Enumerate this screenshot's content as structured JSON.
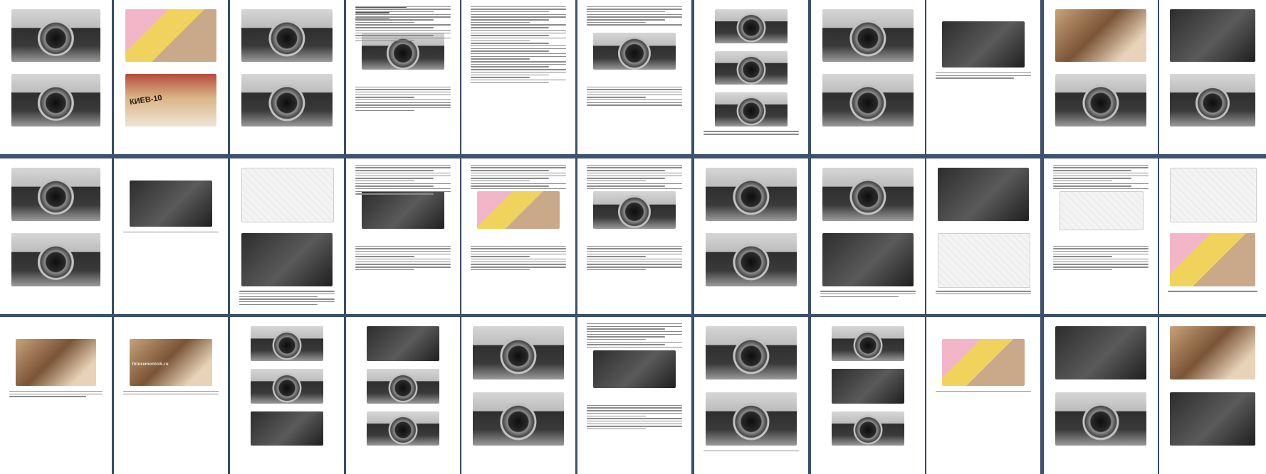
{
  "rows": [
    [
      {
        "photos": [
          {
            "kind": "cam"
          },
          {
            "kind": "cam"
          }
        ],
        "caption": "",
        "text_lines": 0
      },
      {
        "photos": [
          {
            "kind": "color"
          },
          {
            "kind": "book"
          }
        ],
        "caption": "",
        "text_lines": 0,
        "book_word": "КИЕВ-10"
      },
      {
        "photos": [
          {
            "kind": "cam"
          },
          {
            "kind": "cam"
          }
        ],
        "caption": "",
        "text_lines": 0
      },
      {
        "photos": [
          {
            "kind": "cam"
          }
        ],
        "caption": "",
        "text_lines": 14,
        "has_title": true
      },
      {
        "photos": [],
        "caption": "",
        "text_lines": 30
      },
      {
        "photos": [
          {
            "kind": "cam"
          }
        ],
        "caption": "",
        "text_lines": 8
      },
      {
        "photos": [
          {
            "kind": "cam"
          },
          {
            "kind": "cam"
          },
          {
            "kind": "cam"
          }
        ],
        "caption": "",
        "text_lines": 2
      },
      {
        "photos": [
          {
            "kind": "cam"
          },
          {
            "kind": "cam"
          }
        ],
        "caption": "",
        "text_lines": 0
      },
      {
        "photos": [
          {
            "kind": "dark"
          }
        ],
        "caption": "",
        "text_lines": 3
      },
      {
        "photos": [
          {
            "kind": "warm"
          },
          {
            "kind": "cam"
          }
        ],
        "caption": "",
        "text_lines": 0
      },
      {
        "photos": [
          {
            "kind": "dark"
          },
          {
            "kind": "cam"
          }
        ],
        "caption": "",
        "text_lines": 0
      }
    ],
    [
      {
        "photos": [
          {
            "kind": "cam"
          },
          {
            "kind": "cam"
          }
        ],
        "caption": "",
        "text_lines": 0
      },
      {
        "photos": [
          {
            "kind": "dark"
          }
        ],
        "caption": "",
        "text_lines": 1
      },
      {
        "photos": [
          {
            "kind": "diagram"
          },
          {
            "kind": "dark"
          }
        ],
        "caption": "",
        "text_lines": 6
      },
      {
        "photos": [
          {
            "kind": "dark"
          }
        ],
        "caption": "",
        "text_lines": 12
      },
      {
        "photos": [
          {
            "kind": "color"
          }
        ],
        "caption": "",
        "text_lines": 10
      },
      {
        "photos": [
          {
            "kind": "cam"
          }
        ],
        "caption": "",
        "text_lines": 10
      },
      {
        "photos": [
          {
            "kind": "cam"
          },
          {
            "kind": "cam"
          }
        ],
        "caption": "",
        "text_lines": 0
      },
      {
        "photos": [
          {
            "kind": "cam"
          },
          {
            "kind": "dark"
          }
        ],
        "caption": "",
        "text_lines": 3
      },
      {
        "photos": [
          {
            "kind": "dark"
          },
          {
            "kind": "diagram"
          }
        ],
        "caption": "",
        "text_lines": 2
      },
      {
        "photos": [
          {
            "kind": "diagram"
          }
        ],
        "caption": "",
        "text_lines": 10
      },
      {
        "photos": [
          {
            "kind": "diagram"
          },
          {
            "kind": "color"
          }
        ],
        "caption": "",
        "text_lines": 1
      }
    ],
    [
      {
        "photos": [
          {
            "kind": "warm"
          }
        ],
        "caption": "",
        "text_lines": 3
      },
      {
        "photos": [
          {
            "kind": "warm"
          }
        ],
        "caption": "",
        "text_lines": 2,
        "watermark": "fotoremontnik.ru"
      },
      {
        "photos": [
          {
            "kind": "cam"
          },
          {
            "kind": "cam"
          },
          {
            "kind": "dark"
          }
        ],
        "caption": "",
        "text_lines": 0
      },
      {
        "photos": [
          {
            "kind": "dark"
          },
          {
            "kind": "cam"
          },
          {
            "kind": "cam"
          }
        ],
        "caption": "",
        "text_lines": 0
      },
      {
        "photos": [
          {
            "kind": "cam"
          },
          {
            "kind": "cam"
          }
        ],
        "caption": "",
        "text_lines": 0
      },
      {
        "photos": [
          {
            "kind": "dark"
          }
        ],
        "caption": "",
        "text_lines": 10
      },
      {
        "photos": [
          {
            "kind": "cam"
          },
          {
            "kind": "cam"
          }
        ],
        "caption": "",
        "text_lines": 1
      },
      {
        "photos": [
          {
            "kind": "cam"
          },
          {
            "kind": "dark"
          },
          {
            "kind": "cam"
          }
        ],
        "caption": "",
        "text_lines": 0
      },
      {
        "photos": [
          {
            "kind": "color"
          }
        ],
        "caption": "",
        "text_lines": 1
      },
      {
        "photos": [
          {
            "kind": "dark"
          },
          {
            "kind": "cam"
          }
        ],
        "caption": "",
        "text_lines": 0
      },
      {
        "photos": [
          {
            "kind": "warm"
          },
          {
            "kind": "dark"
          }
        ],
        "caption": "",
        "text_lines": 0
      }
    ]
  ]
}
